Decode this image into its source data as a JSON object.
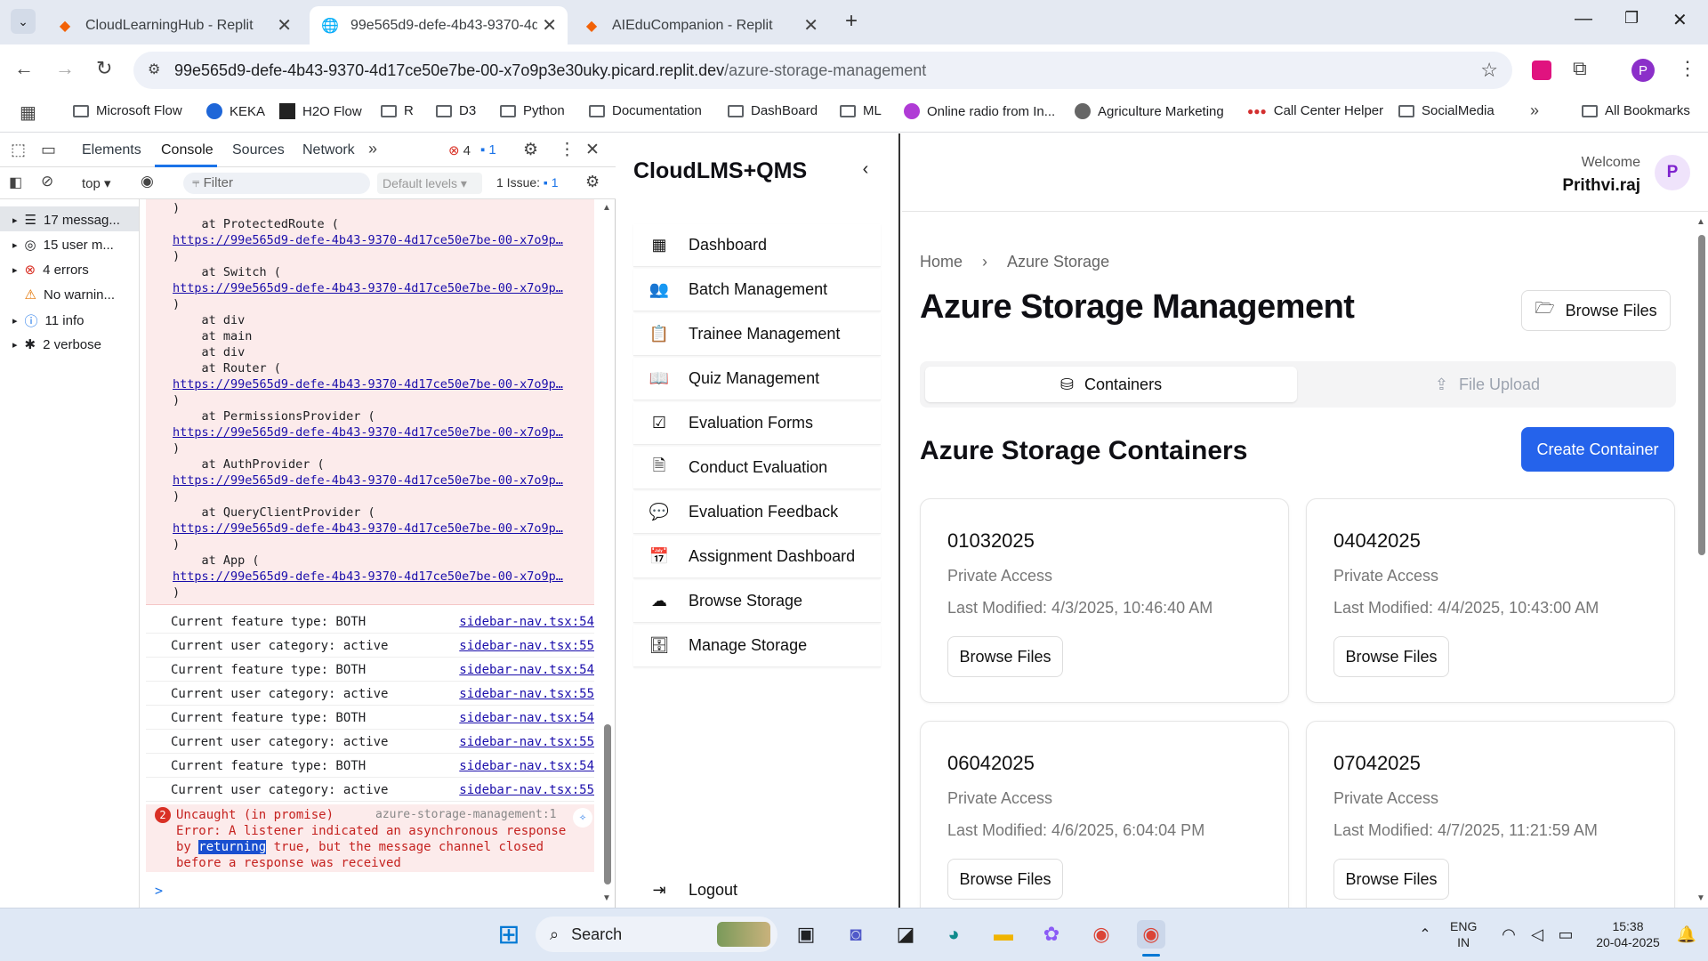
{
  "browser": {
    "tabs": [
      {
        "title": "CloudLearningHub - Replit"
      },
      {
        "title": "99e565d9-defe-4b43-9370-4d1"
      },
      {
        "title": "AIEduCompanion - Replit"
      }
    ],
    "address_host": "99e565d9-defe-4b43-9370-4d17ce50e7be-00-x7o9p3e30uky.picard.replit.dev",
    "address_path": "/azure-storage-management",
    "bookmarks": [
      "Microsoft Flow",
      "KEKA",
      "H2O Flow",
      "R",
      "D3",
      "Python",
      "Documentation",
      "DashBoard",
      "ML",
      "Online radio from In...",
      "Agriculture Marketing",
      "Call Center Helper",
      "SocialMedia"
    ],
    "all_bookmarks": "All Bookmarks",
    "profile_initial": "P"
  },
  "devtools": {
    "tabs": [
      "Elements",
      "Console",
      "Sources",
      "Network"
    ],
    "error_count": "4",
    "message_count": "1",
    "context": "top",
    "filter_placeholder": "Filter",
    "levels": "Default levels",
    "issues_label": "1 Issue:",
    "issues_count": "1",
    "sidebar": [
      {
        "label": "17 messag..."
      },
      {
        "label": "15 user m..."
      },
      {
        "label": "4 errors"
      },
      {
        "label": "No warnin..."
      },
      {
        "label": "11 info"
      },
      {
        "label": "2 verbose"
      }
    ],
    "stack_url": "https://99e565d9-defe-4b43-9370-4d17ce50e7be-00-x7o9p…",
    "stack_lines": {
      "l0": ")",
      "l1": "    at ProtectedRoute (",
      "l3": ")",
      "l4": "    at Switch (",
      "l6": ")",
      "l7": "    at div",
      "l8": "    at main",
      "l9": "    at div",
      "l10": "    at Router (",
      "l12": ")",
      "l13": "    at PermissionsProvider (",
      "l15": ")",
      "l16": "    at AuthProvider (",
      "l18": ")",
      "l19": "    at QueryClientProvider (",
      "l21": ")",
      "l22": "    at App (",
      "l24": ")"
    },
    "logs": [
      {
        "msg": "Current feature type: BOTH",
        "src": "sidebar-nav.tsx:54"
      },
      {
        "msg": "Current user category: active",
        "src": "sidebar-nav.tsx:55"
      },
      {
        "msg": "Current feature type: BOTH",
        "src": "sidebar-nav.tsx:54"
      },
      {
        "msg": "Current user category: active",
        "src": "sidebar-nav.tsx:55"
      },
      {
        "msg": "Current feature type: BOTH",
        "src": "sidebar-nav.tsx:54"
      },
      {
        "msg": "Current user category: active",
        "src": "sidebar-nav.tsx:55"
      },
      {
        "msg": "Current feature type: BOTH",
        "src": "sidebar-nav.tsx:54"
      },
      {
        "msg": "Current user category: active",
        "src": "sidebar-nav.tsx:55"
      }
    ],
    "error2": {
      "count": "2",
      "head": "Uncaught (in promise)",
      "src": "azure-storage-management:1",
      "line1": "Error: A listener indicated an asynchronous response",
      "line2_pre": "by ",
      "line2_sel": "returning",
      "line2_post": " true, but the message channel closed",
      "line3": "before a response was received"
    },
    "prompt": ">"
  },
  "app": {
    "brand": "CloudLMS+QMS",
    "nav": [
      {
        "label": "Dashboard",
        "icon": "grid-icon"
      },
      {
        "label": "Batch Management",
        "icon": "users-icon"
      },
      {
        "label": "Trainee Management",
        "icon": "clipboard-icon"
      },
      {
        "label": "Quiz Management",
        "icon": "book-open-icon"
      },
      {
        "label": "Evaluation Forms",
        "icon": "check-square-icon"
      },
      {
        "label": "Conduct Evaluation",
        "icon": "file-text-icon"
      },
      {
        "label": "Evaluation Feedback",
        "icon": "message-square-icon"
      },
      {
        "label": "Assignment Dashboard",
        "icon": "calendar-icon"
      },
      {
        "label": "Browse Storage",
        "icon": "cloud-icon"
      },
      {
        "label": "Manage Storage",
        "icon": "database-icon"
      }
    ],
    "logout": "Logout",
    "welcome": "Welcome",
    "user_name": "Prithvi.raj",
    "avatar_initial": "P",
    "breadcrumb": [
      "Home",
      "Azure Storage"
    ],
    "page_title": "Azure Storage Management",
    "browse_files_header": "Browse Files",
    "tab_containers": "Containers",
    "tab_upload": "File Upload",
    "section_title": "Azure Storage Containers",
    "create_button": "Create Container",
    "containers": [
      {
        "name": "01032025",
        "access": "Private Access",
        "modified": "Last Modified: 4/3/2025, 10:46:40 AM",
        "button": "Browse Files"
      },
      {
        "name": "04042025",
        "access": "Private Access",
        "modified": "Last Modified: 4/4/2025, 10:43:00 AM",
        "button": "Browse Files"
      },
      {
        "name": "06042025",
        "access": "Private Access",
        "modified": "Last Modified: 4/6/2025, 6:04:04 PM",
        "button": "Browse Files"
      },
      {
        "name": "07042025",
        "access": "Private Access",
        "modified": "Last Modified: 4/7/2025, 11:21:59 AM",
        "button": "Browse Files"
      }
    ]
  },
  "taskbar": {
    "search": "Search",
    "lang1": "ENG",
    "lang2": "IN",
    "time": "15:38",
    "date": "20-04-2025"
  },
  "colors": {
    "primary": "#2563eb",
    "error_bg": "#fcebeb",
    "avatar_bg": "#efe3fb"
  }
}
